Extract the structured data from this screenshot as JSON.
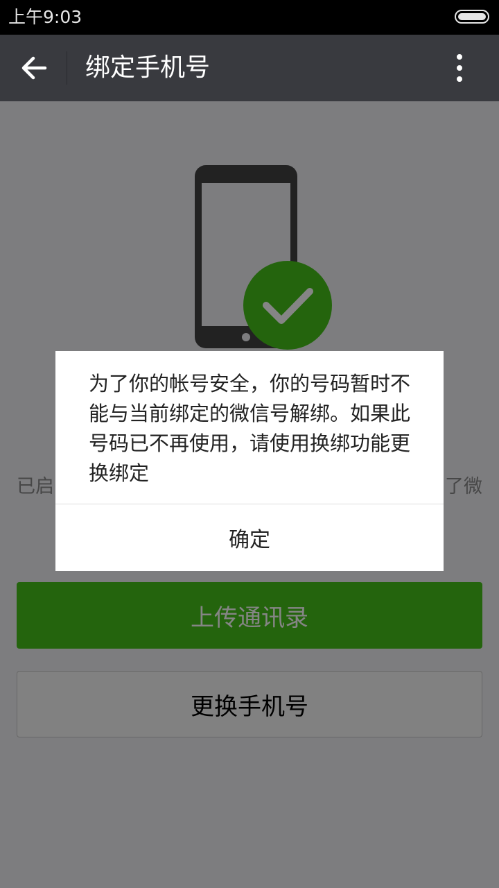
{
  "status_bar": {
    "time": "上午9:03"
  },
  "header": {
    "back_icon": "arrow-left-icon",
    "title": "绑定手机号",
    "more_icon": "more-vertical-icon"
  },
  "main": {
    "illustration": {
      "icon": "phone-check-icon",
      "accent_color": "#45c01a"
    },
    "status_text_left": "已启",
    "status_text_right": "了微",
    "upload_contacts_label": "上传通讯录",
    "change_phone_label": "更换手机号"
  },
  "dialog": {
    "message": "为了你的帐号安全，你的号码暂时不能与当前绑定的微信号解绑。如果此号码已不再使用，请使用换绑功能更换绑定",
    "confirm_label": "确定"
  },
  "colors": {
    "title_bar": "#393a3f",
    "primary_green": "#45c01a",
    "page_bg": "#efeff4"
  }
}
